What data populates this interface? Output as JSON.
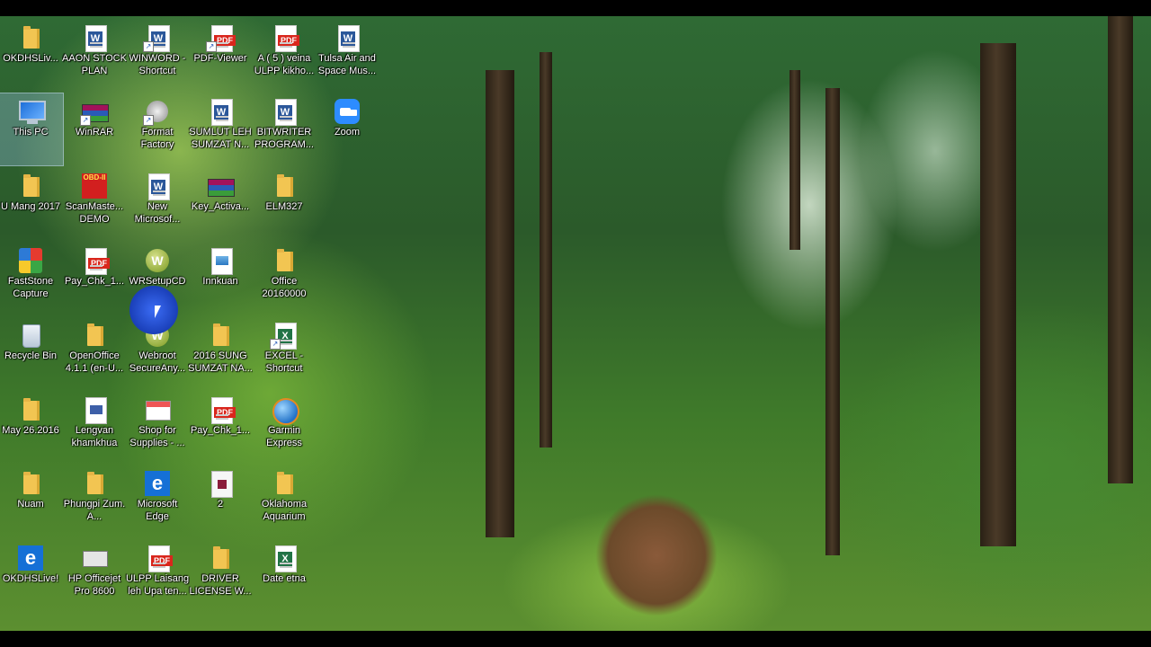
{
  "desktop": {
    "icons": [
      {
        "label": "OKDHSLiv...",
        "icon": "folder-icon"
      },
      {
        "label": "AAON STOCK PLAN",
        "icon": "word-document-icon"
      },
      {
        "label": "WINWORD - Shortcut",
        "icon": "word-app-icon"
      },
      {
        "label": "PDF-Viewer",
        "icon": "pdf-viewer-icon"
      },
      {
        "label": "A ( 5 ) veina ULPP kikho...",
        "icon": "pdf-icon"
      },
      {
        "label": "Tulsa Air and Space Mus...",
        "icon": "word-document-icon"
      },
      {
        "label": "This PC",
        "icon": "computer-icon"
      },
      {
        "label": "WinRAR",
        "icon": "winrar-icon"
      },
      {
        "label": "Format Factory",
        "icon": "format-factory-icon"
      },
      {
        "label": "SUMLUT LEH SUMZAT N...",
        "icon": "word-document-icon"
      },
      {
        "label": "BITWRITER PROGRAM...",
        "icon": "word-document-icon"
      },
      {
        "label": "Zoom",
        "icon": "zoom-icon"
      },
      {
        "label": "U Mang 2017",
        "icon": "folder-icon"
      },
      {
        "label": "ScanMaste... DEMO",
        "icon": "obd-scanmaster-icon"
      },
      {
        "label": "New Microsof...",
        "icon": "word-document-icon"
      },
      {
        "label": "Key_Activa...",
        "icon": "archive-icon"
      },
      {
        "label": "ELM327",
        "icon": "folder-icon"
      },
      {
        "label": "FastStone Capture",
        "icon": "faststone-icon"
      },
      {
        "label": "Pay_Chk_1...",
        "icon": "pdf-icon"
      },
      {
        "label": "WRSetupCD",
        "icon": "webroot-icon"
      },
      {
        "label": "Innkuan",
        "icon": "image-file-icon"
      },
      {
        "label": "Office 20160000",
        "icon": "folder-icon"
      },
      {
        "label": "Recycle Bin",
        "icon": "recycle-bin-icon"
      },
      {
        "label": "OpenOffice 4.1.1 (en-U...",
        "icon": "folder-icon"
      },
      {
        "label": "Webroot SecureAny...",
        "icon": "webroot-icon"
      },
      {
        "label": "2016 SUNG SUMZAT NA...",
        "icon": "folder-icon"
      },
      {
        "label": "EXCEL - Shortcut",
        "icon": "excel-icon"
      },
      {
        "label": "May 26.2016",
        "icon": "folder-icon"
      },
      {
        "label": "Lengvan khamkhua",
        "icon": "wmv-file-icon"
      },
      {
        "label": "Shop for Supplies - ...",
        "icon": "shop-icon"
      },
      {
        "label": "Pay_Chk_1...",
        "icon": "pdf-icon"
      },
      {
        "label": "Garmin Express",
        "icon": "globe-icon"
      },
      {
        "label": "Nuam",
        "icon": "folder-icon"
      },
      {
        "label": "Phungpi Zum. A...",
        "icon": "folder-icon"
      },
      {
        "label": "Microsoft Edge",
        "icon": "edge-icon"
      },
      {
        "label": "2",
        "icon": "video-file-icon"
      },
      {
        "label": "Oklahoma Aquarium",
        "icon": "folder-icon"
      },
      {
        "label": "OKDHSLive!",
        "icon": "edge-icon"
      },
      {
        "label": "HP Officejet Pro 8600",
        "icon": "printer-icon"
      },
      {
        "label": "ULPP Laisang leh Upa ten...",
        "icon": "pdf-icon"
      },
      {
        "label": "DRIVER LICENSE W...",
        "icon": "folder-icon"
      },
      {
        "label": "Date etna",
        "icon": "excel-icon"
      }
    ]
  }
}
